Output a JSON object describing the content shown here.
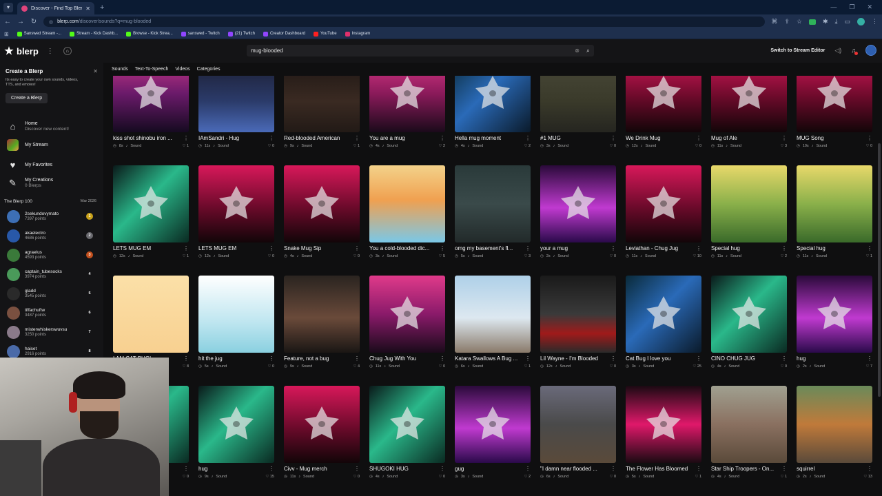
{
  "browser": {
    "tab_title": "Discover - Find Top Blerps, Stre",
    "url_host": "blerp.com",
    "url_path": "/discover/sounds?q=mug-blooded",
    "bookmarks": [
      {
        "label": "Sanswed Stream -...",
        "color": "#53fc18"
      },
      {
        "label": "Stream - Kick Dashb...",
        "color": "#53fc18"
      },
      {
        "label": "Browse - Kick Strea...",
        "color": "#53fc18"
      },
      {
        "label": "sanswed - Twitch",
        "color": "#9146ff"
      },
      {
        "label": "(21) Twitch",
        "color": "#9146ff"
      },
      {
        "label": "Creator Dashboard",
        "color": "#9146ff"
      },
      {
        "label": "YouTube",
        "color": "#ff2020"
      },
      {
        "label": "Instagram",
        "color": "#e1306c"
      }
    ]
  },
  "header": {
    "logo_text": "blerp",
    "search_value": "mug-blooded",
    "switch_label": "Switch to Stream Editor"
  },
  "sidebar": {
    "create": {
      "title": "Create a Blerp",
      "desc": "Its easy to create your own sounds, videos, TTS, and emotes!",
      "button": "Create a Blerp"
    },
    "nav": [
      {
        "label": "Home",
        "sub": "Discover new content!"
      },
      {
        "label": "My Stream",
        "sub": ""
      },
      {
        "label": "My Favorites",
        "sub": ""
      },
      {
        "label": "My Creations",
        "sub": "0 Blerps"
      }
    ],
    "blerp100": {
      "title": "The Blerp 100",
      "date": "Mar 2026",
      "leaders": [
        {
          "name": "2sekundovymato",
          "points": "7397 points",
          "rank": "1",
          "rank_color": "#c9a21a",
          "avatar_color": "#3d6fb5"
        },
        {
          "name": "akaelectro",
          "points": "4686 points",
          "rank": "2",
          "rank_color": "#6b6b70",
          "avatar_color": "#2858a8"
        },
        {
          "name": "agraelus",
          "points": "4593 points",
          "rank": "3",
          "rank_color": "#c4511e",
          "avatar_color": "#3a7a3a"
        },
        {
          "name": "captain_tubesocks",
          "points": "3974 points",
          "rank": "4",
          "rank_color": "transparent",
          "avatar_color": "#4a9a5a"
        },
        {
          "name": "gladd",
          "points": "3545 points",
          "rank": "5",
          "rank_color": "transparent",
          "avatar_color": "#2a2a2a"
        },
        {
          "name": "tiffachuftw",
          "points": "3487 points",
          "rank": "6",
          "rank_color": "transparent",
          "avatar_color": "#7a5040"
        },
        {
          "name": "misterwhiskerswuvsu",
          "points": "3250 points",
          "rank": "7",
          "rank_color": "transparent",
          "avatar_color": "#8a7a8a"
        },
        {
          "name": "haiset",
          "points": "2916 points",
          "rank": "8",
          "rank_color": "transparent",
          "avatar_color": "#4a6aa8"
        }
      ]
    }
  },
  "filters": [
    "Sounds",
    "Text-To-Speech",
    "Videos",
    "Categories"
  ],
  "type_label": "Sound",
  "cards": [
    [
      {
        "title": "kiss shot shinobu iron ...",
        "dur": "8s",
        "likes": "1",
        "bg": "linear-gradient(180deg,#d13a8a 0%,#6a1a6a 50%,#150a20 100%)",
        "star": true
      },
      {
        "title": "IAmSandri - Hug",
        "dur": "11s",
        "likes": "0",
        "bg": "linear-gradient(180deg,#1a1a2a 0%,#2b3b6a 60%,#4a6ab8 100%)",
        "star": false
      },
      {
        "title": "Red-blooded American",
        "dur": "9s",
        "likes": "1",
        "bg": "linear-gradient(180deg,#1a1412 0%,#3a2a22 60%,#221a16 100%)",
        "star": false
      },
      {
        "title": "You are a mug",
        "dur": "4s",
        "likes": "2",
        "bg": "linear-gradient(180deg,#e03a8a 0%,#8a1a5a 50%,#1a0a1a 100%)",
        "star": true
      },
      {
        "title": "Hella mug moment",
        "dur": "4s",
        "likes": "2",
        "bg": "linear-gradient(135deg,#0a2a3a 0%,#2a6ab8 45%,#0a1a2a 100%)",
        "star": true
      },
      {
        "title": "#1 MUG",
        "dur": "3s",
        "likes": "0",
        "bg": "linear-gradient(180deg,#4a4a3a 0%,#3a3a2a 60%,#252520 100%)",
        "star": false
      },
      {
        "title": "We Drink Mug",
        "dur": "12s",
        "likes": "0",
        "bg": "linear-gradient(180deg,#d8185a 0%,#6a0a2a 55%,#120508 100%)",
        "star": true
      },
      {
        "title": "Mug of Ale",
        "dur": "11s",
        "likes": "3",
        "bg": "linear-gradient(180deg,#d8185a 0%,#6a0a2a 55%,#120508 100%)",
        "star": true
      },
      {
        "title": "MUG Song",
        "dur": "10s",
        "likes": "0",
        "bg": "linear-gradient(180deg,#d8185a 0%,#6a0a2a 55%,#120508 100%)",
        "star": true
      }
    ],
    [
      {
        "title": "LETS MUG EM",
        "dur": "12s",
        "likes": "1",
        "bg": "linear-gradient(135deg,#0a1a1a 0%,#2ab88a 45%,#0a2a22 100%)",
        "star": true
      },
      {
        "title": "LETS MUG EM",
        "dur": "12s",
        "likes": "0",
        "bg": "linear-gradient(180deg,#d8185a 0%,#6a0a2a 55%,#120508 100%)",
        "star": true
      },
      {
        "title": "Snake Mug Sip",
        "dur": "4s",
        "likes": "0",
        "bg": "linear-gradient(180deg,#d8185a 0%,#6a0a2a 55%,#120508 100%)",
        "star": true
      },
      {
        "title": "You a cold-blooded dic...",
        "dur": "3s",
        "likes": "5",
        "bg": "linear-gradient(180deg,#f3d28a 0%,#f0a050 45%,#7ac8e8 100%)",
        "star": false
      },
      {
        "title": "omg my basement's fl...",
        "dur": "5s",
        "likes": "3",
        "bg": "linear-gradient(180deg,#2a3a3a 0%,#3a4a4a 50%,#222a2a 100%)",
        "star": false
      },
      {
        "title": "your a mug",
        "dur": "2s",
        "likes": "0",
        "bg": "linear-gradient(180deg,#2a0a3a 0%,#c03ad0 55%,#2a0a4a 100%)",
        "star": true
      },
      {
        "title": "Leviathan - Chug Jug",
        "dur": "11s",
        "likes": "10",
        "bg": "linear-gradient(180deg,#d8185a 0%,#6a0a2a 55%,#120508 100%)",
        "star": true
      },
      {
        "title": "Special hug",
        "dur": "11s",
        "likes": "2",
        "bg": "linear-gradient(180deg,#e8d86a 0%,#8ab04a 50%,#3a6a2a 100%)",
        "star": false
      },
      {
        "title": "Special hug",
        "dur": "11s",
        "likes": "1",
        "bg": "linear-gradient(180deg,#e8d86a 0%,#8ab04a 50%,#3a6a2a 100%)",
        "star": false
      }
    ],
    [
      {
        "title": "I AM CAT BUG!",
        "dur": "8s",
        "likes": "8",
        "bg": "linear-gradient(180deg,#fbe0a8 0%,#f8d090 100%)",
        "star": false
      },
      {
        "title": "hit the jug",
        "dur": "5s",
        "likes": "0",
        "bg": "linear-gradient(180deg,#ffffff 0%,#bfe6f0 60%,#8ad0e0 100%)",
        "star": false
      },
      {
        "title": "Feature, not a bug",
        "dur": "9s",
        "likes": "4",
        "bg": "linear-gradient(180deg,#2a2420 0%,#6a4a3a 55%,#1a1614 100%)",
        "star": false
      },
      {
        "title": "Chug Jug With You",
        "dur": "11s",
        "likes": "0",
        "bg": "linear-gradient(180deg,#e03a8a 0%,#8a1a6a 50%,#1a0a1a 100%)",
        "star": true
      },
      {
        "title": "Katara Swallows A Bug ...",
        "dur": "6s",
        "likes": "1",
        "bg": "linear-gradient(180deg,#aed0e8 0%,#dde8f0 55%,#8a7a6a 100%)",
        "star": false
      },
      {
        "title": "Lil Wayne - I'm Blooded",
        "dur": "12s",
        "likes": "0",
        "bg": "linear-gradient(180deg,#1a1a1a 0%,#3a3a3a 50%,#a01a1a 75%,#2a2a2a 100%)",
        "star": false
      },
      {
        "title": "Cat Bug I love you",
        "dur": "3s",
        "likes": "25",
        "bg": "linear-gradient(135deg,#0a2a3a 0%,#2a6ab8 45%,#0a1a2a 100%)",
        "star": true
      },
      {
        "title": "CINO CHUG JUG",
        "dur": "4s",
        "likes": "0",
        "bg": "linear-gradient(135deg,#0a1a1a 0%,#2ab88a 45%,#0a2a22 100%)",
        "star": true
      },
      {
        "title": "hug",
        "dur": "2s",
        "likes": "7",
        "bg": "linear-gradient(180deg,#2a0a3a 0%,#c03ad0 55%,#2a0a4a 100%)",
        "star": true
      }
    ],
    [
      {
        "title": "",
        "dur": "",
        "likes": "0",
        "bg": "linear-gradient(135deg,#0a1a1a 0%,#2ab88a 45%,#0a2a22 100%)",
        "star": true
      },
      {
        "title": "hug",
        "dur": "9s",
        "likes": "15",
        "bg": "linear-gradient(135deg,#0a1a1a 0%,#2ab88a 45%,#0a2a22 100%)",
        "star": true
      },
      {
        "title": "Civv - Mug merch",
        "dur": "11s",
        "likes": "0",
        "bg": "linear-gradient(180deg,#d8185a 0%,#6a0a2a 55%,#120508 100%)",
        "star": true
      },
      {
        "title": "SHUGOKI HUG",
        "dur": "4s",
        "likes": "0",
        "bg": "linear-gradient(135deg,#0a1a1a 0%,#2ab88a 45%,#0a2a22 100%)",
        "star": true
      },
      {
        "title": "gug",
        "dur": "3s",
        "likes": "2",
        "bg": "linear-gradient(180deg,#2a0a3a 0%,#c03ad0 55%,#2a0a4a 100%)",
        "star": true
      },
      {
        "title": "\"I damn near flooded ...",
        "dur": "6s",
        "likes": "0",
        "bg": "linear-gradient(180deg,#6a6a7a 0%,#4a4a4a 50%,#5a4a3a 100%)",
        "star": false
      },
      {
        "title": "The Flower Has Bloomed",
        "dur": "5s",
        "likes": "1",
        "bg": "linear-gradient(180deg,#1a0a12 0%,#e0186a 50%,#1a0a12 100%)",
        "star": true
      },
      {
        "title": "Star Ship Troopers - On...",
        "dur": "4s",
        "likes": "1",
        "bg": "linear-gradient(180deg,#a0a090 0%,#8a7060 50%,#5a4a3a 100%)",
        "star": false
      },
      {
        "title": "squirrel",
        "dur": "2s",
        "likes": "13",
        "bg": "linear-gradient(180deg,#6a8a5a 0%,#c07a3a 50%,#5a4a3a 100%)",
        "star": false
      }
    ]
  ]
}
